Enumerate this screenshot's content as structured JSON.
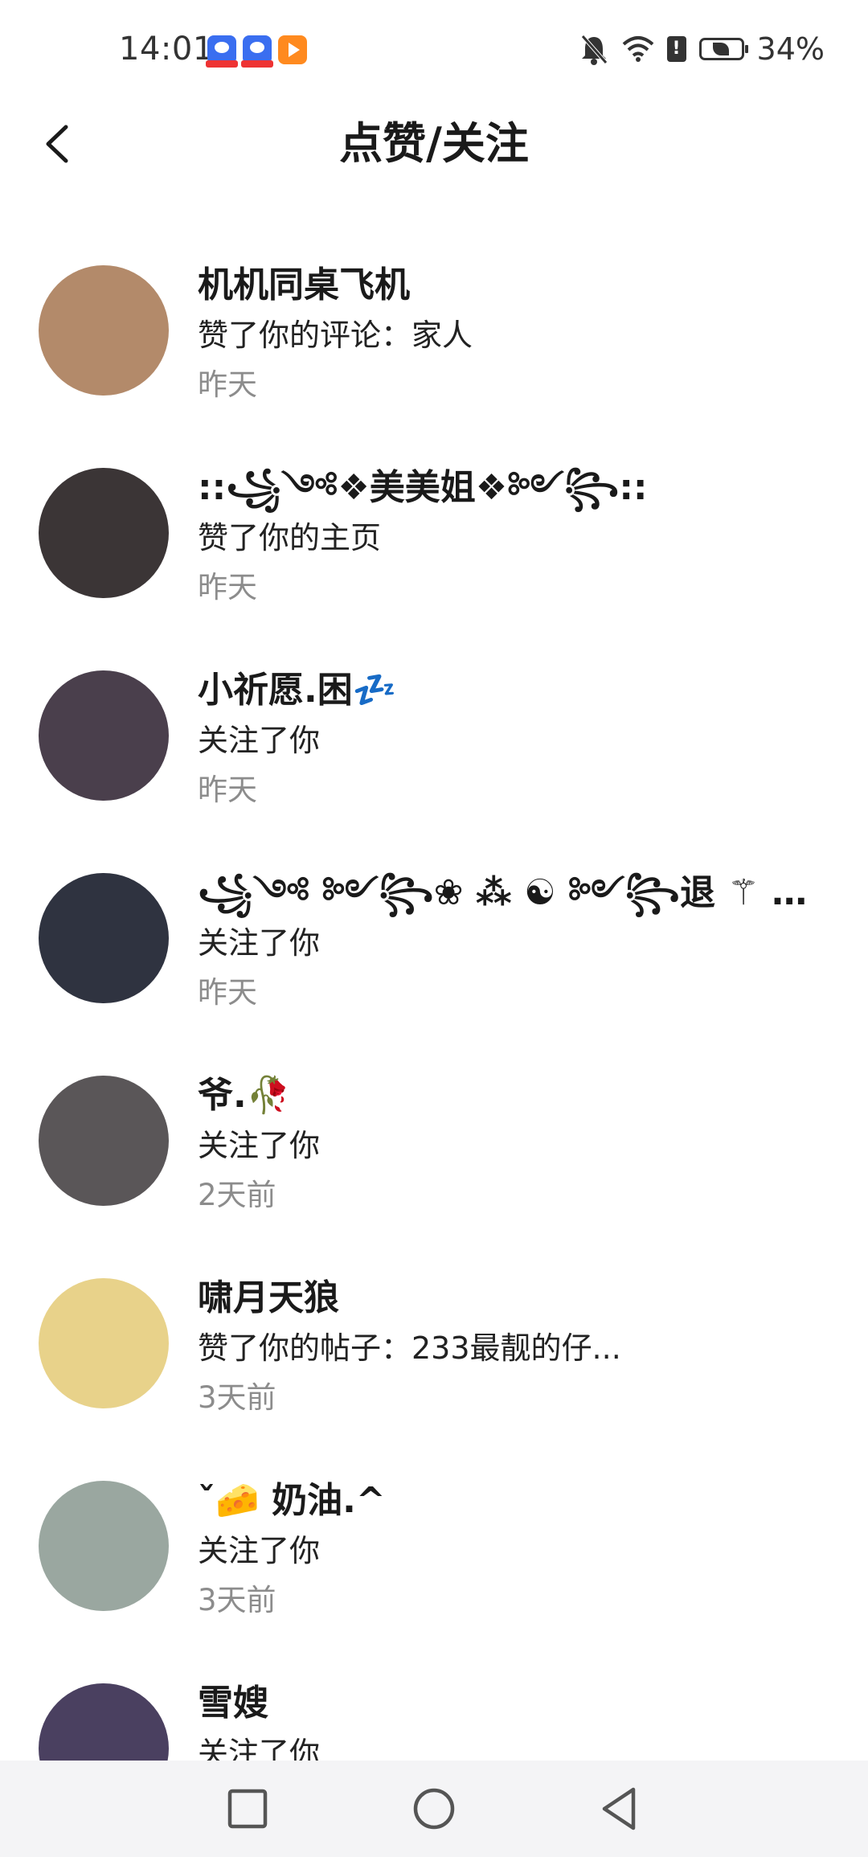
{
  "status_bar": {
    "time": "14:01",
    "battery_percent": "34%",
    "apps": [
      "baidu-icon",
      "baidu-icon",
      "video-play-icon"
    ],
    "icons": [
      "bell-muted-icon",
      "wifi-icon",
      "sim-alert-icon",
      "battery-saver-icon"
    ]
  },
  "header": {
    "title": "点赞/关注",
    "back_icon": "chevron-left-icon"
  },
  "notifications": [
    {
      "name": "机机同桌飞机",
      "action": "赞了你的评论：家人",
      "time": "昨天",
      "avatar_color": "#b38a6a"
    },
    {
      "name": "::꧁༺❖美美姐❖༻꧂::",
      "action": "赞了你的主页",
      "time": "昨天",
      "avatar_color": "#3b3536"
    },
    {
      "name": "小祈愿.困💤",
      "action": "关注了你",
      "time": "昨天",
      "avatar_color": "#4a3f4c"
    },
    {
      "name": "꧁༺ ༻꧂❀ ⁂ ☯ ༻꧂退 ⚚ 了...",
      "action": "关注了你",
      "time": "昨天",
      "avatar_color": "#2f3340"
    },
    {
      "name": "爷.🥀",
      "action": "关注了你",
      "time": "2天前",
      "avatar_color": "#5a5658"
    },
    {
      "name": "啸月天狼",
      "action": "赞了你的帖子：233最靓的仔...",
      "time": "3天前",
      "avatar_color": "#e8d28a"
    },
    {
      "name": "ˇ🧀 奶油.^",
      "action": "关注了你",
      "time": "3天前",
      "avatar_color": "#9aa7a0"
    },
    {
      "name": "雪嫂",
      "action": "关注了你",
      "time": "",
      "avatar_color": "#4a4060"
    }
  ],
  "nav": {
    "icons": [
      "recent-apps-icon",
      "home-icon",
      "back-triangle-icon"
    ],
    "background": "#f4f4f6"
  }
}
